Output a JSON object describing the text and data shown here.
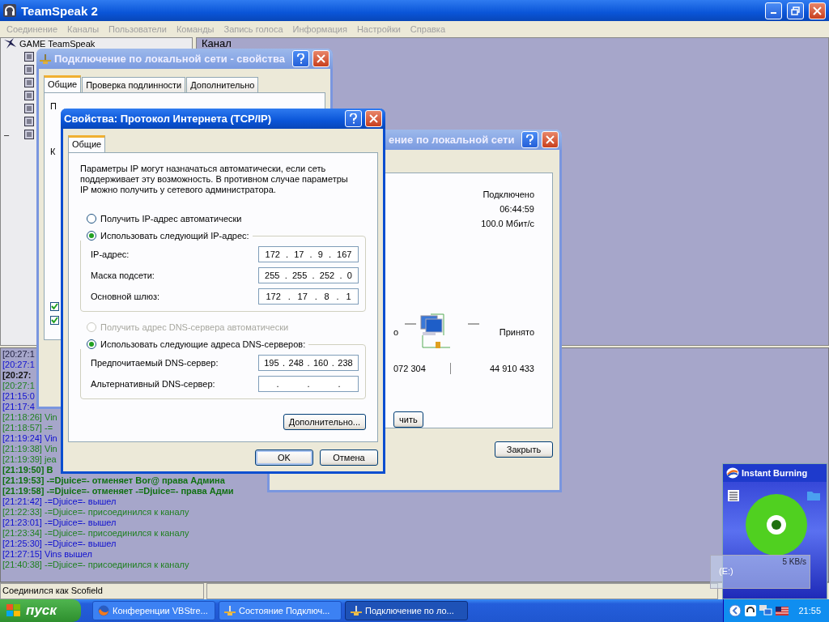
{
  "main_window": {
    "title": "TeamSpeak 2",
    "menu": [
      "Соединение",
      "Каналы",
      "Пользователи",
      "Команды",
      "Запись голоса",
      "Информация",
      "Настройки",
      "Справка"
    ],
    "tree": {
      "server": "GAME TeamSpeak",
      "channels": [
        {
          "kind": "channel"
        },
        {
          "kind": "channel"
        },
        {
          "kind": "channel"
        },
        {
          "kind": "channel"
        },
        {
          "kind": "channel"
        },
        {
          "kind": "channel"
        },
        {
          "kind": "channel",
          "toggle": "–"
        }
      ]
    },
    "panel_heading": "Канал",
    "log": [
      {
        "text": "[20:27:1",
        "color": "#202040",
        "bold": false
      },
      {
        "text": "[20:27:1",
        "color": "#1010d0",
        "bold": false
      },
      {
        "text": "[20:27:",
        "color": "#101010",
        "bold": true
      },
      {
        "text": "[20:27:1",
        "color": "#208020",
        "bold": false
      },
      {
        "text": "[21:15:0",
        "color": "#1010d0",
        "bold": false
      },
      {
        "text": "[21:17:4",
        "color": "#1010d0",
        "bold": false
      },
      {
        "text": "[21:18:26] Vin",
        "color": "#208020",
        "bold": false
      },
      {
        "text": "[21:18:57] -=",
        "color": "#208020",
        "bold": false
      },
      {
        "text": "[21:19:24] Vin",
        "color": "#1010d0",
        "bold": false
      },
      {
        "text": "[21:19:38] Vin",
        "color": "#208020",
        "bold": false
      },
      {
        "text": "[21:19:39] jea",
        "color": "#208020",
        "bold": false
      },
      {
        "text": "[21:19:50] B",
        "color": "#107010",
        "bold": true
      },
      {
        "text": "[21:19:53] -=Djuice=- отменяет Bor@  права Админа",
        "color": "#107010",
        "bold": true
      },
      {
        "text": "[21:19:58] -=Djuice=- отменяет -=Djuice=-  права Адми",
        "color": "#107010",
        "bold": true
      },
      {
        "text": "[21:21:42] -=Djuice=- вышел",
        "color": "#1010d0",
        "bold": false
      },
      {
        "text": "[21:22:33] -=Djuice=- присоединился к каналу",
        "color": "#208020",
        "bold": false
      },
      {
        "text": "[21:23:01] -=Djuice=- вышел",
        "color": "#1010d0",
        "bold": false
      },
      {
        "text": "[21:23:34] -=Djuice=- присоединился к каналу",
        "color": "#208020",
        "bold": false
      },
      {
        "text": "[21:25:30] -=Djuice=- вышел",
        "color": "#1010d0",
        "bold": false
      },
      {
        "text": "[21:27:15] Vins вышел",
        "color": "#1010d0",
        "bold": false
      },
      {
        "text": "[21:40:38] -=Djuice=- присоединился к каналу",
        "color": "#208020",
        "bold": false
      }
    ],
    "status": "Соединился как Scofield"
  },
  "lan_properties": {
    "title": "Подключение по локальной сети - свойства",
    "tabs": [
      {
        "label": "Общие",
        "selected": true
      },
      {
        "label": "Проверка подлинности",
        "selected": false
      },
      {
        "label": "Дополнительно",
        "selected": false
      }
    ],
    "labels": [
      "П",
      "К"
    ],
    "checkboxes": [
      {
        "checked": true
      },
      {
        "checked": true
      }
    ]
  },
  "lan_status": {
    "title": "ение по локальной сети",
    "status": "Подключено",
    "duration": "06:44:59",
    "speed": "100.0 Мбит/с",
    "sent_label": "о",
    "received_label": "Принято",
    "sent": "072 304",
    "received": "44 910 433",
    "disconnect_button": "чить",
    "close_button": "Закрыть"
  },
  "tcpip": {
    "title": "Свойства: Протокол Интернета (TCP/IP)",
    "tabs": [
      {
        "label": "Общие",
        "selected": true
      }
    ],
    "intro": "Параметры IP могут назначаться автоматически, если сеть поддерживает эту возможность. В противном случае параметры IP можно получить у сетевого администратора.",
    "ip_options": [
      {
        "label": "Получить IP-адрес автоматически",
        "selected": false,
        "disabled": false
      },
      {
        "label": "Использовать следующий IP-адрес:",
        "selected": true,
        "disabled": false
      }
    ],
    "ip_fields": [
      {
        "label": "IP-адрес:",
        "parts": [
          "172",
          ".",
          "17",
          ".",
          "9",
          ".",
          "167"
        ]
      },
      {
        "label": "Маска подсети:",
        "parts": [
          "255",
          ".",
          "255",
          ".",
          "252",
          ".",
          "0"
        ]
      },
      {
        "label": "Основной шлюз:",
        "parts": [
          "172",
          ".",
          "17",
          ".",
          "8",
          ".",
          "1"
        ]
      }
    ],
    "dns_options": [
      {
        "label": "Получить адрес DNS-сервера автоматически",
        "selected": false,
        "disabled": true
      },
      {
        "label": "Использовать следующие адреса DNS-серверов:",
        "selected": true,
        "disabled": false
      }
    ],
    "dns_fields": [
      {
        "label": "Предпочитаемый DNS-сервер:",
        "parts": [
          "195",
          ".",
          "248",
          ".",
          "160",
          ".",
          "238"
        ]
      },
      {
        "label": "Альтернативный DNS-сервер:",
        "parts": [
          ".",
          ".",
          "."
        ]
      }
    ],
    "advanced_button": "Дополнительно...",
    "buttons": [
      {
        "label": "OK",
        "kind": "default"
      },
      {
        "label": "Отмена",
        "kind": "normal"
      }
    ]
  },
  "burner": {
    "title": "Instant Burning",
    "rate": "5 KB/s",
    "drive": "(E:)"
  },
  "taskbar": {
    "start": "пуск",
    "tasks": [
      {
        "label": "Конференции VBStre...",
        "selected": false
      },
      {
        "label": "Состояние Подключ...",
        "selected": false
      },
      {
        "label": "Подключение по ло...",
        "selected": true
      }
    ],
    "clock": "21:55"
  }
}
